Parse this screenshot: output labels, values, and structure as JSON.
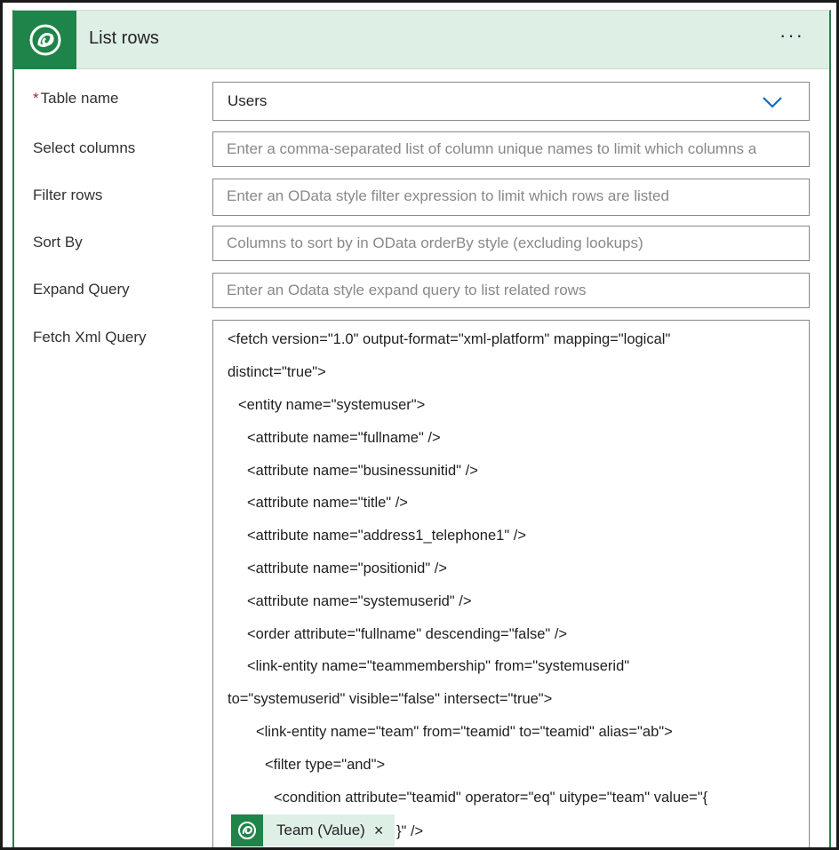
{
  "header": {
    "title": "List rows",
    "more_label": "···",
    "icon": "dataverse-icon",
    "accent_color": "#1e8449",
    "header_bg": "#deefe6"
  },
  "fields": {
    "table_name": {
      "label": "Table name",
      "required_mark": "*",
      "value": "Users"
    },
    "select_columns": {
      "label": "Select columns",
      "placeholder": "Enter a comma-separated list of column unique names to limit which columns a"
    },
    "filter_rows": {
      "label": "Filter rows",
      "placeholder": "Enter an OData style filter expression to limit which rows are listed"
    },
    "sort_by": {
      "label": "Sort By",
      "placeholder": "Columns to sort by in OData orderBy style (excluding lookups)"
    },
    "expand_query": {
      "label": "Expand Query",
      "placeholder": "Enter an Odata style expand query to list related rows"
    },
    "fetch_xml": {
      "label": "Fetch Xml Query",
      "lines": [
        "<fetch version=\"1.0\" output-format=\"xml-platform\" mapping=\"logical\"",
        "distinct=\"true\">",
        "<entity name=\"systemuser\">",
        "<attribute name=\"fullname\" />",
        "<attribute name=\"businessunitid\" />",
        "<attribute name=\"title\" />",
        "<attribute name=\"address1_telephone1\" />",
        "<attribute name=\"positionid\" />",
        "<attribute name=\"systemuserid\" />",
        "<order attribute=\"fullname\" descending=\"false\" />",
        "<link-entity name=\"teammembership\" from=\"systemuserid\"",
        "to=\"systemuserid\" visible=\"false\" intersect=\"true\">",
        "<link-entity name=\"team\" from=\"teamid\" to=\"teamid\" alias=\"ab\">",
        "<filter type=\"and\">",
        "<condition attribute=\"teamid\" operator=\"eq\" uitype=\"team\" value=\"{",
        "}\" />"
      ],
      "token": {
        "label": "Team (Value)",
        "close": "×",
        "icon": "dataverse-icon"
      }
    }
  }
}
